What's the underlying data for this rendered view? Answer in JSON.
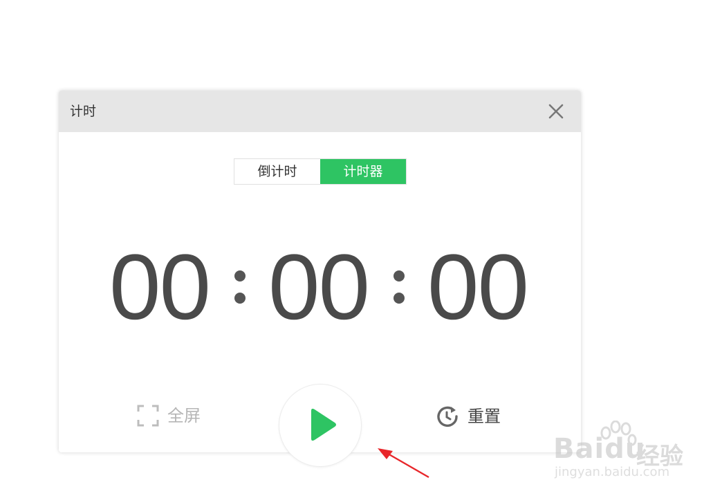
{
  "window": {
    "title": "计时"
  },
  "tabs": [
    {
      "label": "倒计时",
      "active": false
    },
    {
      "label": "计时器",
      "active": true
    }
  ],
  "timer": {
    "hours": "00",
    "minutes": "00",
    "seconds": "00"
  },
  "controls": {
    "fullscreen_label": "全屏",
    "reset_label": "重置",
    "play_icon": "play-icon"
  },
  "watermark": {
    "logo": "Bai",
    "logo_suffix": "du",
    "cn": "经验",
    "url": "jingyan.baidu.com"
  },
  "colors": {
    "accent": "#2ec463",
    "title_bar": "#e6e6e6",
    "digits": "#4a4a4a",
    "annotation_arrow": "#e8262a"
  }
}
